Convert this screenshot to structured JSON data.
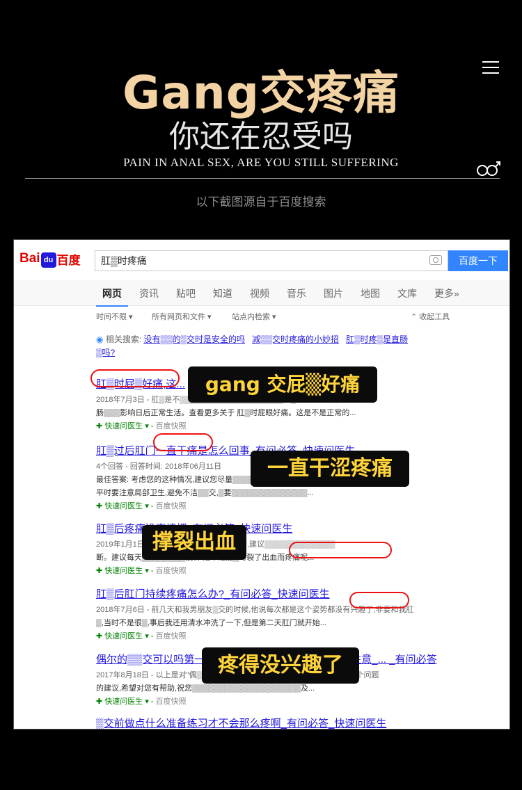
{
  "hero": {
    "title": "Gang交疼痛",
    "subtitle": "你还在忍受吗",
    "english": "PAIN IN ANAL SEX, ARE YOU STILL SUFFERING",
    "caption": "以下截图源自于百度搜索"
  },
  "screenshot": {
    "logo_left": "Bai",
    "logo_paw": "du",
    "logo_right": "百度",
    "search_query": "肛▒时疼痛",
    "search_button": "百度一下",
    "tabs": [
      "网页",
      "资讯",
      "贴吧",
      "知道",
      "视频",
      "音乐",
      "图片",
      "地图",
      "文库",
      "更多»"
    ],
    "filters": {
      "time": "时间不限",
      "type": "所有网页和文件",
      "site": "站点内检索",
      "collapse": "收起工具"
    },
    "related": {
      "label": "相关搜索:",
      "q1": "没有▒▒的▒交时是安全的吗",
      "q2": "减▒▒交时疼痛的小妙招",
      "q3": "肛▒时疼▒是直肠",
      "q3b": "▒吗?"
    },
    "results": [
      {
        "title": "肛▒时屁▒好痛,这...",
        "meta": "2018年7月3日 - 肛▒是不▒▒▒▒▒▒▒▒▒▒▒▒▒▒▒▒▒▒▒肛▒。以免已发肛",
        "text": "肠▒▒▒影响日后正常生活。查看更多关于 肛▒时屁眼好痛。这是不是正常的...",
        "source": "快速问医生",
        "snapshot": "百度快照"
      },
      {
        "title": "肛▒过后肛门一直干痛是怎么回事_有问必答_快速问医生",
        "meta": "4个回答 - 回答时间: 2018年06月11日",
        "text": "最佳答案: 考虑您的这种情况,建议您尽量▒▒▒▒▒▒▒▒▒▒▒▒▒▒▒▒▒▒,建议你",
        "text2": "平时要注意局部卫生,避免不洁▒▒交,▒要▒▒▒▒▒▒▒▒▒▒▒▒▒▒...",
        "source": "快速问医生",
        "snapshot": "百度快照"
      },
      {
        "title": "肛▒后疼痛没事情把_有问必答_快速问医生",
        "meta": "2019年1月1日 - ▒▒▒▒▒▒▒▒▒▒是▒▒导致的,建议▒▒▒▒▒▒▒▒▒▒▒▒▒",
        "text": "断。建议每天▒▒▒▒▒▒▒▒投诉 是不是肛▒时裂了出血而疼痛呢...",
        "source": "快速问医生",
        "snapshot": "百度快照"
      },
      {
        "title": "肛▒后肛门持续疼痛怎么办?_有问必答_快速问医生",
        "meta": "2018年7月6日 - 前几天和我男朋友▒交的时候,他说每次都是这个姿势都没有兴趣了,非要和我肛",
        "text": "▒,当时不是很▒,事后我还用清水冲洗了一下,但是第二天肛门就开始...",
        "source": "快速问医生",
        "snapshot": "百度快照"
      },
      {
        "title": "偶尔的▒▒交可以吗第一次有没有用不会很疼痛有什么要注意_... _有问必答",
        "meta": "2017年8月18日 - 以上是对\"偶▒▒▒▒▒▒▒▒▒▒▒▒▒▒▒▒▒▒▒有什么要注意\"这个问题",
        "text": "的建议,希望对您有帮助,祝您▒▒▒▒▒▒▒▒▒▒▒▒▒▒▒▒▒▒▒▒及...",
        "source": "快速问医生",
        "snapshot": "百度快照"
      },
      {
        "title": "▒交前做点什么准备练习才不会那么疼啊_有问必答_快速问医生"
      }
    ],
    "overlays": {
      "b1": "gang 交屁▒好痛",
      "b2": "一直干涩疼痛",
      "b3": "撑裂出血",
      "b4": "疼得没兴趣了"
    }
  },
  "colors": {
    "accent": "#f3d3a3",
    "link": "#2319dc",
    "badge_text": "#ffd43a",
    "circle": "#e11111"
  }
}
